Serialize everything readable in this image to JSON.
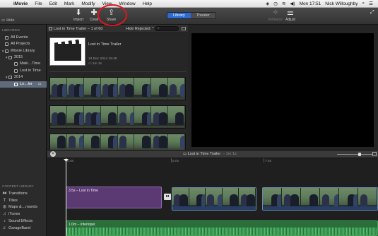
{
  "menubar": {
    "app_name": "iMovie",
    "items": [
      "File",
      "Edit",
      "Mark",
      "Modify",
      "View",
      "Window",
      "Help"
    ],
    "status_icons": [
      "dropbox-icon",
      "clock-icon",
      "wifi-icon",
      "volume-icon"
    ],
    "clock": "Mon 17:51",
    "user": "Nick Willoughby"
  },
  "toolbar": {
    "import_label": "Import",
    "create_label": "Creat",
    "share_label": "Share",
    "tabs": {
      "library": "Library",
      "theater": "Theater"
    },
    "enhance_label": "Enhance",
    "adjust_label": "Adjust",
    "hide_label": "Hide"
  },
  "sidebar": {
    "libraries_header": "LIBRARIES",
    "all_events": "All Events",
    "all_projects": "All Projects",
    "library": "iMovie Library",
    "year_2015": "2015",
    "event_making": "Maki…Time",
    "event_lost": "Lost in Time",
    "year_2014": "2014",
    "event_selected": "Lo…ler",
    "content_header": "CONTENT LIBRARY",
    "content_items": [
      "Transitions",
      "Titles",
      "Maps &…rounds",
      "iTunes",
      "Sound Effects",
      "GarageBand"
    ]
  },
  "browser": {
    "title": "Lost in Time Trailer – 1 of 60",
    "filter": "Hide Rejected ⌃",
    "project_name": "Lost in Time Trailer",
    "project_date": "14 Dec 2014 15:48",
    "project_length": "1m 1s"
  },
  "timeline": {
    "project_name": "Lost in Time Trailer",
    "duration": "– 1m 1s",
    "ticks": [
      "0.0s",
      "5.0s",
      "7.5s"
    ],
    "title_clip": "3.5s – Lost in Time",
    "audio_clip": "1.0m – Interloper",
    "colors": {
      "title": "#5b3a73",
      "audio": "#2a6e3a",
      "video_border": "#6a8aad"
    }
  },
  "annotation": {
    "color": "#e0161b"
  }
}
